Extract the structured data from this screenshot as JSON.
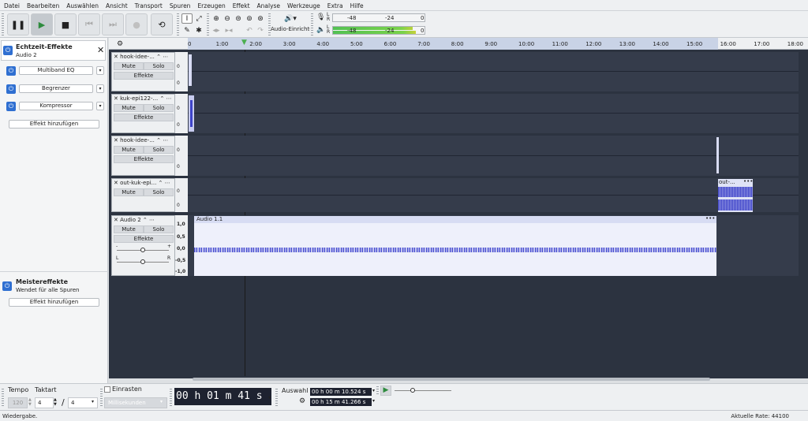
{
  "menu": [
    "Datei",
    "Bearbeiten",
    "Auswählen",
    "Ansicht",
    "Transport",
    "Spuren",
    "Erzeugen",
    "Effekt",
    "Analyse",
    "Werkzeuge",
    "Extra",
    "Hilfe"
  ],
  "toolbar": {
    "audio_setup": "Audio-Einrichtung",
    "rec_meter": {
      "l": "L",
      "r": "R",
      "m48": "-48",
      "m24": "-24",
      "zero": "0"
    },
    "play_meter": {
      "l": "L",
      "r": "R",
      "m48": "-48",
      "m24": "-24",
      "zero": "0"
    }
  },
  "left": {
    "title": "Echtzeit-Effekte",
    "subtitle": "Audio 2",
    "effects": [
      "Multiband EQ",
      "Begrenzer",
      "Kompressor"
    ],
    "add_effect": "Effekt hinzufügen",
    "master_title": "Meistereffekte",
    "master_sub": "Wendet für alle Spuren",
    "master_add": "Effekt hinzufügen"
  },
  "ruler": [
    "0",
    "1:00",
    "2:00",
    "3:00",
    "4:00",
    "5:00",
    "6:00",
    "7:00",
    "8:00",
    "9:00",
    "10:00",
    "11:00",
    "12:00",
    "13:00",
    "14:00",
    "15:00",
    "16:00",
    "17:00",
    "18:00"
  ],
  "tracks": [
    {
      "name": "hook-idee-...",
      "mute": "Mute",
      "solo": "Solo",
      "effects": "Effekte",
      "scale": [
        "0",
        "0"
      ]
    },
    {
      "name": "kuk-epi122-...",
      "mute": "Mute",
      "solo": "Solo",
      "effects": "Effekte",
      "scale": [
        "0",
        "0"
      ]
    },
    {
      "name": "hook-idee-...",
      "mute": "Mute",
      "solo": "Solo",
      "effects": "Effekte",
      "scale": [
        "0",
        "0"
      ]
    },
    {
      "name": "out-kuk-epi...",
      "mute": "Mute",
      "solo": "Solo",
      "scale": [
        "0",
        "0"
      ],
      "clip": "out-..."
    },
    {
      "name": "Audio 2",
      "mute": "Mute",
      "solo": "Solo",
      "effects": "Effekte",
      "scale": [
        "1,0",
        "0,5",
        "0,0",
        "-0,5",
        "-1,0"
      ],
      "clip": "Audio 1.1",
      "gain_minus": "-",
      "gain_plus": "+",
      "pan_l": "L",
      "pan_r": "R"
    }
  ],
  "bottom": {
    "tempo_label": "Tempo",
    "tempo": "120",
    "takt_label": "Taktart",
    "takt_num": "4",
    "takt_sep": "/",
    "takt_den": "4",
    "snap_label": "Einrasten",
    "snap_unit": "Millisekunden",
    "time": "00 h 01 m 41 s",
    "selection_label": "Auswahl",
    "sel_start": "00 h 00 m 10.524 s",
    "sel_end": "00 h 15 m 41.266 s"
  },
  "status": {
    "left": "Wiedergabe.",
    "right": "Aktuelle Rate: 44100"
  }
}
